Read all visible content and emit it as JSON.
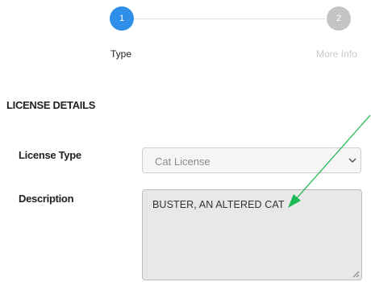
{
  "stepper": {
    "steps": [
      {
        "number": "1",
        "label": "Type",
        "state": "active"
      },
      {
        "number": "2",
        "label": "More Info",
        "state": "inactive"
      }
    ],
    "colors": {
      "active": "#2f8fe8",
      "inactive": "#c4c4c4",
      "inactive_label": "#c8c8c8"
    }
  },
  "section": {
    "title": "LICENSE DETAILS"
  },
  "form": {
    "license_type": {
      "label": "License Type",
      "value": "Cat License"
    },
    "description": {
      "label": "Description",
      "value": "BUSTER, AN ALTERED CAT"
    }
  },
  "annotation": {
    "type": "arrow",
    "color": "#1db954",
    "icon": "arrow-annotation"
  }
}
